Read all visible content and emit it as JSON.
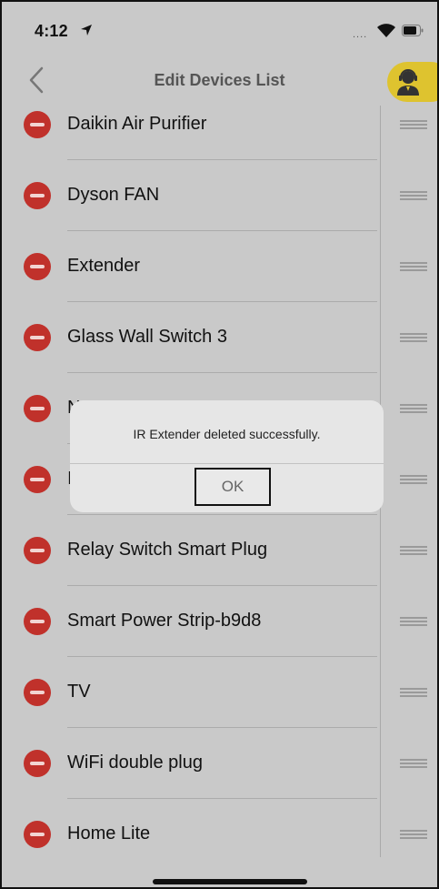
{
  "status_bar": {
    "time": "4:12",
    "signal": "....",
    "icons": [
      "location-arrow-icon",
      "wifi-icon",
      "battery-icon"
    ]
  },
  "header": {
    "title": "Edit Devices List",
    "back_icon": "chevron-left-icon",
    "support_icon": "support-agent-icon"
  },
  "devices": [
    {
      "label": "Daikin Air Purifier"
    },
    {
      "label": "Dyson FAN"
    },
    {
      "label": "Extender"
    },
    {
      "label": "Glass Wall Switch 3"
    },
    {
      "label": "N"
    },
    {
      "label": "I"
    },
    {
      "label": "Relay Switch Smart Plug"
    },
    {
      "label": "Smart Power Strip-b9d8"
    },
    {
      "label": "TV"
    },
    {
      "label": "WiFi double plug"
    },
    {
      "label": "Home Lite"
    }
  ],
  "dialog": {
    "message": "IR Extender deleted successfully.",
    "ok_label": "OK"
  },
  "colors": {
    "delete_red": "#c0312b",
    "support_yellow": "#dec32f",
    "dim_background": "#c9c9c9"
  }
}
